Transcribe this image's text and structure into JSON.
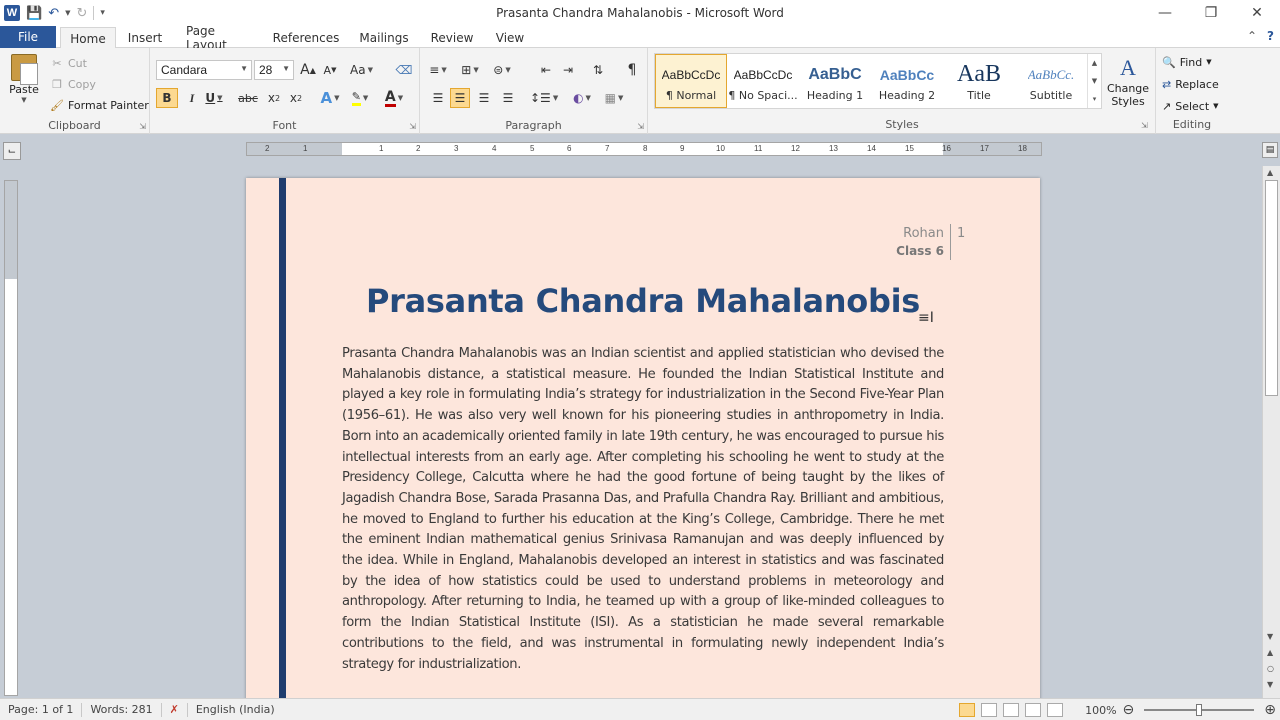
{
  "window": {
    "title": "Prasanta Chandra Mahalanobis  -  Microsoft Word",
    "logo": "W"
  },
  "tabs": {
    "file": "File",
    "items": [
      "Home",
      "Insert",
      "Page Layout",
      "References",
      "Mailings",
      "Review",
      "View"
    ],
    "active": "Home"
  },
  "clipboard": {
    "paste": "Paste",
    "cut": "Cut",
    "copy": "Copy",
    "format_painter": "Format Painter",
    "label": "Clipboard"
  },
  "font": {
    "name": "Candara",
    "size": "28",
    "label": "Font",
    "grow": "A",
    "shrink": "A",
    "change_case": "Aa",
    "bold": "B",
    "italic": "I",
    "underline": "U",
    "strikethrough": "abc",
    "subscript": "x",
    "superscript": "x",
    "text_effects": "A",
    "font_color": "A",
    "accent_color": "#c00000",
    "highlight_color": "#ffff00"
  },
  "paragraph": {
    "label": "Paragraph",
    "pilcrow": "¶"
  },
  "styles": {
    "label": "Styles",
    "items": [
      {
        "preview": "AaBbCcDc",
        "name": "¶ Normal"
      },
      {
        "preview": "AaBbCcDc",
        "name": "¶ No Spaci..."
      },
      {
        "preview": "AaBbC",
        "name": "Heading 1"
      },
      {
        "preview": "AaBbCc",
        "name": "Heading 2"
      },
      {
        "preview": "AaB",
        "name": "Title"
      },
      {
        "preview": "AaBbCc.",
        "name": "Subtitle"
      }
    ],
    "change_styles": "Change Styles",
    "change_styles_icon": "A"
  },
  "editing": {
    "label": "Editing",
    "find": "Find",
    "replace": "Replace",
    "select": "Select"
  },
  "ruler": {
    "numbers": [
      "2",
      "1",
      "1",
      "2",
      "3",
      "4",
      "5",
      "6",
      "7",
      "8",
      "9",
      "10",
      "11",
      "12",
      "13",
      "14",
      "15",
      "16",
      "17",
      "18"
    ]
  },
  "document": {
    "header_name": "Rohan",
    "header_class": "Class 6",
    "page_number": "1",
    "title": "Prasanta Chandra Mahalanobis",
    "body": "Prasanta Chandra Mahalanobis was an Indian scientist and applied statistician who devised the Mahalanobis distance, a statistical measure. He founded the Indian Statistical Institute and played a key role in formulating India’s strategy for industrialization in the Second Five-Year Plan (1956–61). He was also very well known for his pioneering studies in anthropometry in India. Born into an academically oriented family in late 19th century, he was encouraged to pursue his intellectual interests from an early age. After completing his schooling he went to study at the Presidency College, Calcutta where he had the good fortune of being taught by the likes of Jagadish Chandra Bose, Sarada Prasanna Das, and Prafulla Chandra Ray. Brilliant and ambitious, he moved to England to further his education at the King’s College, Cambridge. There he met the eminent Indian mathematical genius Srinivasa Ramanujan and was deeply influenced by the idea. While in England, Mahalanobis developed an interest in statistics and was fascinated by the idea of how statistics could be used to understand problems in meteorology and anthropology. After returning to India, he teamed up with a group of like-minded colleagues to form the Indian Statistical Institute (ISI). As a statistician he made several remarkable contributions to the field, and was instrumental in formulating newly independent India’s strategy for industrialization.",
    "page_color": "#fde6dc",
    "title_color": "#254a7c",
    "bar_color": "#1f3d6e"
  },
  "status": {
    "page": "Page: 1 of 1",
    "words": "Words: 281",
    "language": "English (India)",
    "zoom": "100%"
  },
  "colors": {
    "accent": "#2b579a",
    "ribbon": "#f3f3f3"
  }
}
